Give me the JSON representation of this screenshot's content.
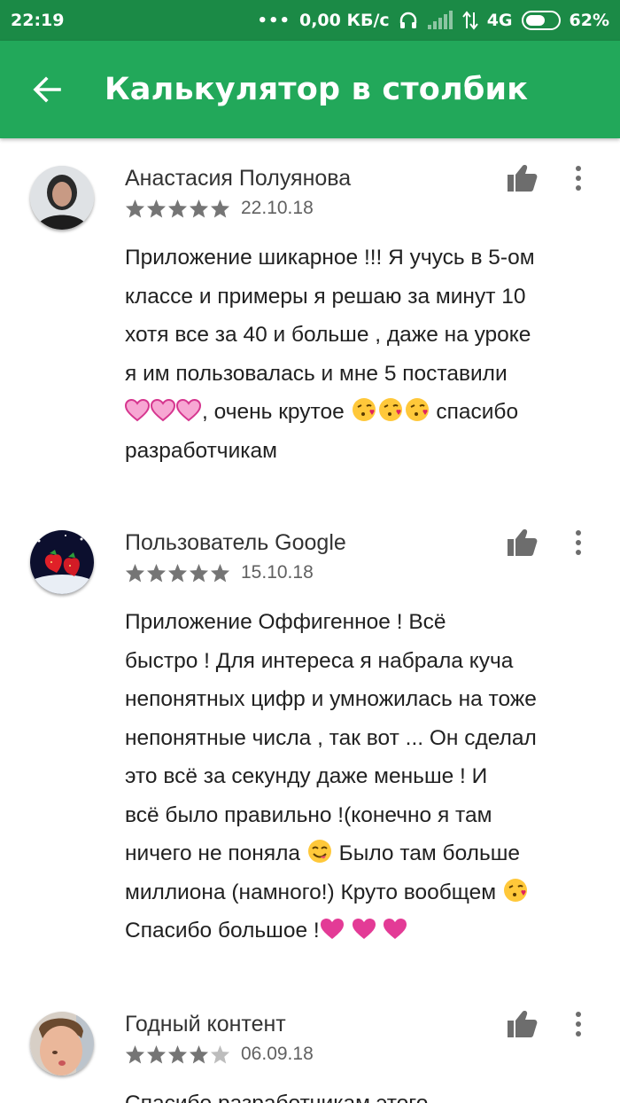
{
  "status_bar": {
    "time": "22:19",
    "dots": "•••",
    "net_speed": "0,00 КБ/с",
    "network": "4G",
    "battery": "62%",
    "battery_level": 0.62
  },
  "app_bar": {
    "title": "Калькулятор в столбик"
  },
  "colors": {
    "status_bar": "#1b8a46",
    "app_bar": "#22a85a",
    "star": "#757575",
    "heart": "#e33b96"
  },
  "reviews": [
    {
      "author": "Анастасия Полуянова",
      "rating": 5,
      "date": "22.10.18",
      "lines": [
        "Приложение шикарное !!! Я учусь в 5-ом",
        "классе и примеры я решаю за минут 10",
        "хотя все за 40 и больше , даже на уроке",
        "я им пользовалась и мне 5 поставили"
      ],
      "line5_text": ", очень крутое ",
      "line5_tail": " спасибо",
      "line6": "разработчикам"
    },
    {
      "author": "Пользователь Google",
      "rating": 5,
      "date": "15.10.18",
      "lines": [
        "Приложение Оффигенное ! Всё",
        "быстро ! Для интереса я набрала куча",
        "непонятных цифр и умножилась на тоже",
        "непонятные числа , так вот ... Он сделал",
        "это всё за секунду даже меньше ! И",
        "всё было правильно !(конечно я там"
      ],
      "line7_a": "ничего не поняла ",
      "line7_b": " Было там больше",
      "line8_a": "миллиона (намного!) Круто вообщем ",
      "line9_a": "Спасибо большое !"
    },
    {
      "author": "Годный контент",
      "rating": 4,
      "date": "06.09.18",
      "partial_line": "Спасибо разработчикам этого"
    }
  ]
}
